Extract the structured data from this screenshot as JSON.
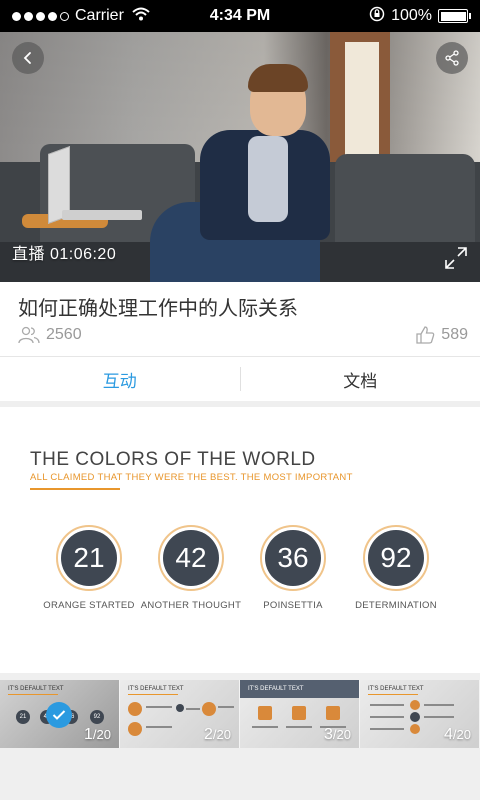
{
  "status_bar": {
    "carrier": "Carrier",
    "time": "4:34 PM",
    "battery": "100%",
    "signal_bars": 4,
    "battery_level": 1.0
  },
  "video": {
    "live_label": "直播 01:06:20"
  },
  "info": {
    "title": "如何正确处理工作中的人际关系",
    "viewers": "2560",
    "likes": "589"
  },
  "tabs": [
    {
      "label": "互动",
      "active": true
    },
    {
      "label": "文档",
      "active": false
    }
  ],
  "slide": {
    "title": "THE COLORS OF THE WORLD",
    "subtitle": "ALL CLAIMED THAT THEY WERE THE BEST. THE MOST IMPORTANT",
    "stats": [
      {
        "value": "21",
        "label": "ORANGE STARTED"
      },
      {
        "value": "42",
        "label": "ANOTHER THOUGHT"
      },
      {
        "value": "36",
        "label": "POINSETTIA"
      },
      {
        "value": "92",
        "label": "DETERMINATION"
      }
    ]
  },
  "thumbnails": [
    {
      "page": "1",
      "total": "/20",
      "heading": "IT'S DEFAULT TEXT",
      "selected": true
    },
    {
      "page": "2",
      "total": "/20",
      "heading": "IT'S DEFAULT TEXT",
      "selected": false
    },
    {
      "page": "3",
      "total": "/20",
      "heading": "IT'S DEFAULT TEXT",
      "selected": false
    },
    {
      "page": "4",
      "total": "/20",
      "heading": "IT'S DEFAULT TEXT",
      "selected": false
    }
  ],
  "colors": {
    "accent": "#2b9ae0",
    "orange": "#e8962c",
    "dark_circle": "#3f4752"
  }
}
